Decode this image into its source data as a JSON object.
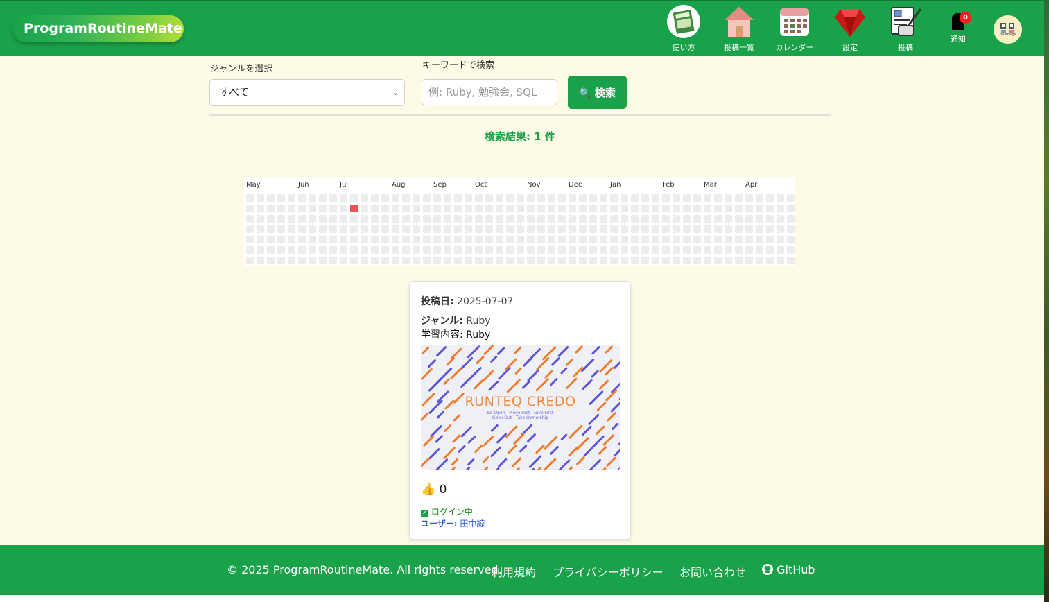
{
  "app": {
    "brand": "ProgramRoutineMate"
  },
  "nav": {
    "items": [
      {
        "label": "使い方",
        "icon": "book-icon"
      },
      {
        "label": "投稿一覧",
        "icon": "house-icon"
      },
      {
        "label": "カレンダー",
        "icon": "calendar-icon"
      },
      {
        "label": "設定",
        "icon": "ruby-gem-icon"
      },
      {
        "label": "投稿",
        "icon": "edit-post-icon"
      },
      {
        "label": "通知",
        "icon": "bell-icon",
        "badge": "0"
      }
    ],
    "avatar_text": "no image"
  },
  "search": {
    "genre_label": "ジャンルを選択",
    "genre_selected": "すべて",
    "keyword_label": "キーワードで検索",
    "keyword_value": "",
    "keyword_placeholder": "例: Ruby, 勉強会, SQL",
    "button_label": "検索",
    "result_text": "検索結果: 1 件"
  },
  "heatmap": {
    "months": [
      "May",
      "Jun",
      "Jul",
      "Aug",
      "Sep",
      "Oct",
      "Nov",
      "Dec",
      "Jan",
      "Feb",
      "Mar",
      "Apr"
    ],
    "weeks": 53,
    "days_per_week": 7,
    "active_cells": [
      {
        "week": 10,
        "day": 1,
        "color": "#f0504f"
      }
    ],
    "empty_color": "#ececec"
  },
  "post": {
    "date_label": "投稿日:",
    "date": "2025-07-07",
    "genre_label": "ジャンル:",
    "genre": "Ruby",
    "content_label": "学習内容:",
    "content": "Ruby",
    "image_title": "RUNTEQ CREDO",
    "image_values_row1": [
      "Be Open",
      "Move Fast",
      "Give First"
    ],
    "image_values_row2": [
      "Geek Out",
      "Take Ownership"
    ],
    "like_count": "0",
    "login_status": "ログイン中",
    "user_label": "ユーザー:",
    "user_name": "田中諒"
  },
  "footer": {
    "copyright": "© 2025 ProgramRoutineMate. All rights reserved.",
    "terms": "利用規約",
    "privacy": "プライバシーポリシー",
    "contact": "お問い合わせ",
    "github": "GitHub"
  },
  "colors": {
    "primary": "#1aa24a",
    "background": "#fdfbe6",
    "accent_red": "#f0504f",
    "link_blue": "#2b5bd7"
  }
}
